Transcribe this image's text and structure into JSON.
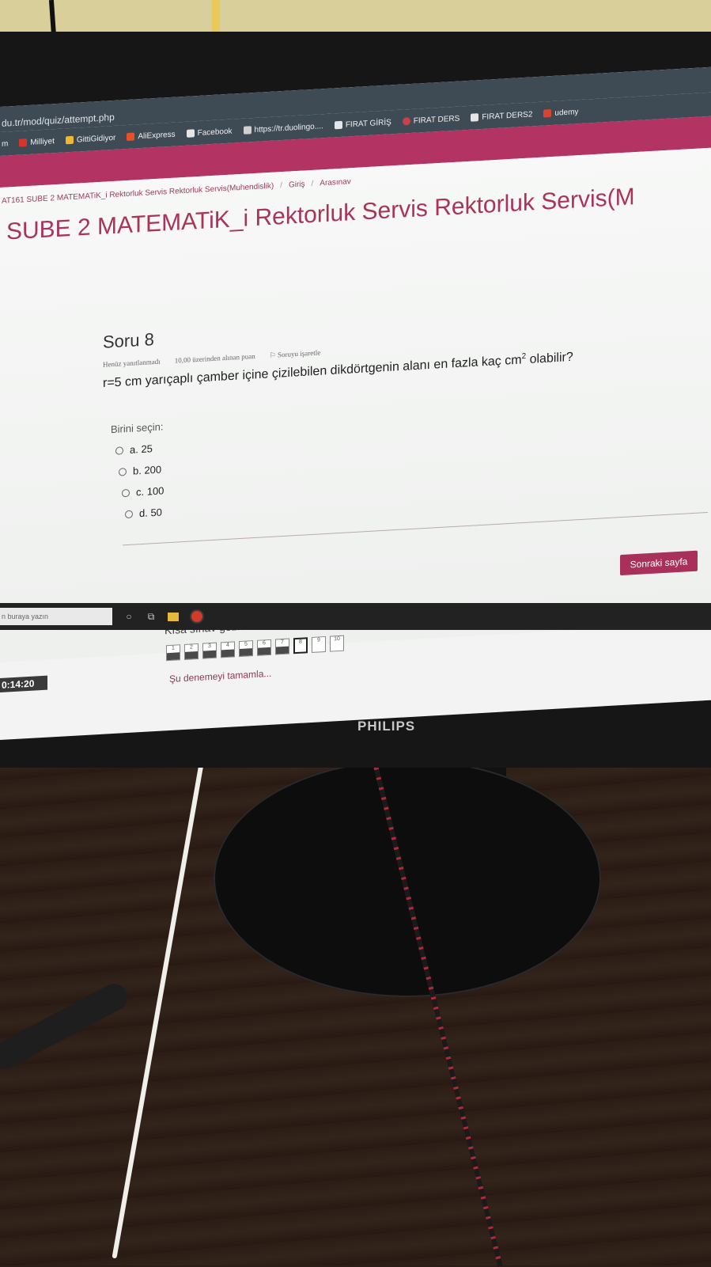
{
  "browser": {
    "url": "du.tr/mod/quiz/attempt.php",
    "bookmarks": [
      {
        "label": "m",
        "icon": "page-icon"
      },
      {
        "label": "Milliyet",
        "icon": "milliyet-icon"
      },
      {
        "label": "GittiGidiyor",
        "icon": "gittigidiyor-icon"
      },
      {
        "label": "AliExpress",
        "icon": "aliexpress-icon"
      },
      {
        "label": "Facebook",
        "icon": "page-icon"
      },
      {
        "label": "https://tr.duolingo....",
        "icon": "apps-grid-icon"
      },
      {
        "label": "FIRAT GİRİŞ",
        "icon": "page-icon"
      },
      {
        "label": "FIRAT DERS",
        "icon": "firat-icon"
      },
      {
        "label": "FIRAT DERS2",
        "icon": "page-icon"
      },
      {
        "label": "udemy",
        "icon": "udemy-icon"
      }
    ]
  },
  "breadcrumb": {
    "course": "AT161 SUBE 2 MATEMATiK_i Rektorluk Servis Rektorluk Servis(Muhendislik)",
    "section": "Giriş",
    "quiz": "Arasınav"
  },
  "page": {
    "title": "SUBE 2 MATEMATiK_i Rektorluk Servis Rektorluk Servis(M"
  },
  "question": {
    "title": "Soru 8",
    "status": "Henüz yanıtlanmadı",
    "points": "10,00 üzerinden alınan puan",
    "flag_label": "Soruyu işaretle",
    "text": "r=5 cm yarıçaplı çamber içine çizilebilen dikdörtgenin alanı en fazla kaç cm",
    "text_sup": "2",
    "text_end": " olabilir?",
    "prompt": "Birini seçin:",
    "options": [
      "a. 25",
      "b. 200",
      "c. 100",
      "d. 50"
    ]
  },
  "buttons": {
    "next": "Sonraki sayfa"
  },
  "quiz_nav": {
    "title": "Kısa sınav gezintisi",
    "pages": [
      {
        "label": "1",
        "state": "answered"
      },
      {
        "label": "2",
        "state": "answered"
      },
      {
        "label": "3",
        "state": "answered"
      },
      {
        "label": "4",
        "state": "answered"
      },
      {
        "label": "5",
        "state": "answered"
      },
      {
        "label": "6",
        "state": "answered"
      },
      {
        "label": "7",
        "state": "answered"
      },
      {
        "label": "8",
        "state": "current"
      },
      {
        "label": "9",
        "state": "empty"
      },
      {
        "label": "10",
        "state": "empty"
      }
    ],
    "finish_link": "Şu denemeyi tamamla..."
  },
  "timer": "0:14:20",
  "taskbar": {
    "search_placeholder": "n buraya yazın"
  },
  "monitor": {
    "brand": "PHILIPS"
  },
  "colors": {
    "accent": "#a8305b",
    "toolbar": "#3f4b54"
  }
}
